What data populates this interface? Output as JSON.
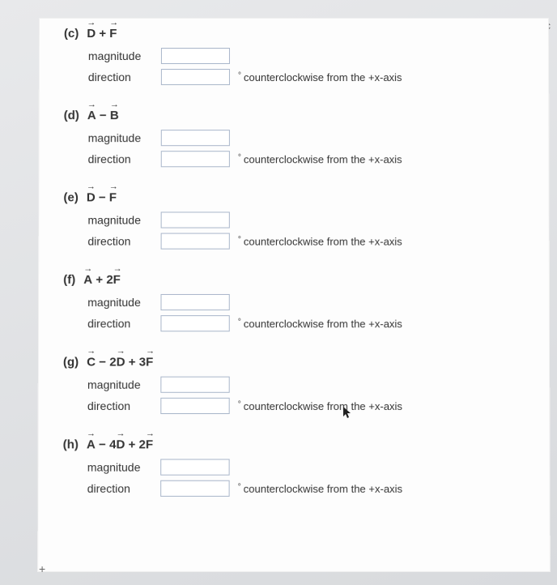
{
  "url_fragment": "Responses/submit?c",
  "direction_unit": "counterclockwise from the +x-axis",
  "magnitude_label": "magnitude",
  "direction_label": "direction",
  "degree_symbol": "°",
  "footer_symbol": "+",
  "problems": [
    {
      "letter": "(c)",
      "expr_html": "<span class='vec'>D</span> + <span class='vec'>F</span>"
    },
    {
      "letter": "(d)",
      "expr_html": "<span class='vec'>A</span> − <span class='vec'>B</span>"
    },
    {
      "letter": "(e)",
      "expr_html": "<span class='vec'>D</span> − <span class='vec'>F</span>"
    },
    {
      "letter": "(f)",
      "expr_html": "<span class='vec'>A</span> + 2<span class='vec'>F</span>"
    },
    {
      "letter": "(g)",
      "expr_html": "<span class='vec'>C</span> − 2<span class='vec'>D</span> + 3<span class='vec'>F</span>"
    },
    {
      "letter": "(h)",
      "expr_html": "<span class='vec'>A</span> − 4<span class='vec'>D</span> + 2<span class='vec'>F</span>"
    }
  ]
}
